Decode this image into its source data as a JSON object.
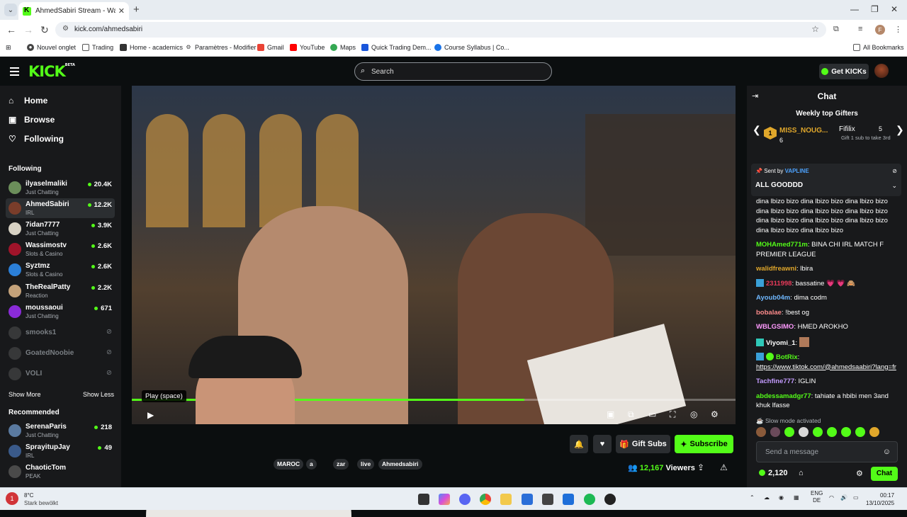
{
  "browser": {
    "tab_title": "AhmedSabiri Stream - Watch Li",
    "url": "kick.com/ahmedsabiri",
    "bookmarks": [
      "Nouvel onglet",
      "Trading",
      "Home - academics",
      "Paramètres - Modifier",
      "Gmail",
      "YouTube",
      "Maps",
      "Quick Trading Dem...",
      "Course Syllabus | Co...",
      "All Bookmarks"
    ],
    "profile_initial": "F"
  },
  "header": {
    "logo": "KICK",
    "logo_badge": "BETA",
    "search_placeholder": "Search",
    "get_kicks": "Get KICKs"
  },
  "sidebar": {
    "nav": [
      {
        "label": "Home",
        "icon": "home-icon"
      },
      {
        "label": "Browse",
        "icon": "browse-icon"
      },
      {
        "label": "Following",
        "icon": "heart-icon"
      }
    ],
    "following_title": "Following",
    "following": [
      {
        "name": "ilyaselmaliki",
        "category": "Just Chatting",
        "viewers": "20.4K",
        "color": "#6b8e5a"
      },
      {
        "name": "AhmedSabiri",
        "category": "IRL",
        "viewers": "12.2K",
        "color": "#7a3d2a"
      },
      {
        "name": "7idan7777",
        "category": "Just Chatting",
        "viewers": "3.9K",
        "color": "#d8d2c4"
      },
      {
        "name": "Wassimostv",
        "category": "Slots & Casino",
        "viewers": "2.6K",
        "color": "#a0142a"
      },
      {
        "name": "Syztmz",
        "category": "Slots & Casino",
        "viewers": "2.6K",
        "color": "#2b7fd8"
      },
      {
        "name": "TheRealPatty",
        "category": "Reaction",
        "viewers": "2.2K",
        "color": "#c4a27a"
      },
      {
        "name": "moussaoui",
        "category": "Just Chatting",
        "viewers": "671",
        "color": "#8a2bd8"
      }
    ],
    "offline": [
      {
        "name": "smooks1"
      },
      {
        "name": "GoatedNoobie"
      },
      {
        "name": "VOLI"
      }
    ],
    "show_more": "Show More",
    "show_less": "Show Less",
    "recommended_title": "Recommended",
    "recommended": [
      {
        "name": "SerenaParis",
        "category": "Just Chatting",
        "viewers": "218",
        "color": "#5a7aa0"
      },
      {
        "name": "SprayitupJay",
        "category": "IRL",
        "viewers": "49",
        "color": "#3a5a8a"
      },
      {
        "name": "ChaoticTom",
        "category": "PEAK",
        "viewers": "",
        "color": "#4a4a4a"
      }
    ]
  },
  "player": {
    "tooltip": "Play (space)",
    "progress": 0.65
  },
  "stream": {
    "tags": [
      "MAROC",
      "a",
      "zar",
      "live",
      "Ahmedsabiri"
    ],
    "gift_subs": "Gift Subs",
    "subscribe": "Subscribe",
    "viewers_count": "12,167",
    "viewers_label": "Viewers"
  },
  "chat": {
    "title": "Chat",
    "gifters_title": "Weekly top Gifters",
    "gifter1": {
      "rank": "1",
      "name": "MISS_NOUG...",
      "count": "6"
    },
    "gifter2": {
      "name": "Fifilix",
      "count": "5",
      "hint": "Gift 1 sub to take 3rd"
    },
    "pinned": {
      "sent_by": "Sent by",
      "user": "VAPLINE",
      "message": "ALL GOODDD"
    },
    "messages": [
      {
        "user": "",
        "color": "#ffffff",
        "text": "dina lbizo bizo dina lbizo bizo dina lbizo bizo dina lbizo bizo dina lbizo bizo dina lbizo bizo dina lbizo bizo dina lbizo bizo dina lbizo bizo dina lbizo bizo dina lbizo bizo"
      },
      {
        "user": "MOHAmed771m",
        "color": "#53fc18",
        "text": "BINA CHI IRL MATCH F PREMIER LEAGUE"
      },
      {
        "user": "walidfreawni",
        "color": "#e0a72b",
        "text": "lbira"
      },
      {
        "user": "2311998",
        "color": "#e83a5a",
        "text": "bassatine 💗 💗 🙈"
      },
      {
        "user": "Ayoub04m",
        "color": "#6fb8ff",
        "text": "dima codm"
      },
      {
        "user": "bobalae",
        "color": "#ff8c8c",
        "text": "!best og"
      },
      {
        "user": "WBLGSIMO",
        "color": "#ff9aff",
        "text": "HMED AROKHO"
      },
      {
        "user": "Viyomi_1",
        "color": "#ffffff",
        "text": ""
      },
      {
        "user": "BotRix",
        "color": "#53fc18",
        "text": "https://www.tiktok.com/@ahmedsaabiri?lang=fr"
      },
      {
        "user": "Tachfine777",
        "color": "#c39bff",
        "text": "IGLIN"
      },
      {
        "user": "abdessamadgr77",
        "color": "#53fc18",
        "text": "tahiate a hbibi men 3and khuk lfasse"
      }
    ],
    "slow_mode": "Slow mode activated",
    "input_placeholder": "Send a message",
    "kicks_balance": "2,120",
    "chat_button": "Chat"
  },
  "taskbar": {
    "temp": "8°C",
    "weather_desc": "Stark bewölkt",
    "weather_badge": "1",
    "lang_top": "ENG",
    "lang_bottom": "DE",
    "time": "00:17",
    "date": "13/10/2025"
  }
}
